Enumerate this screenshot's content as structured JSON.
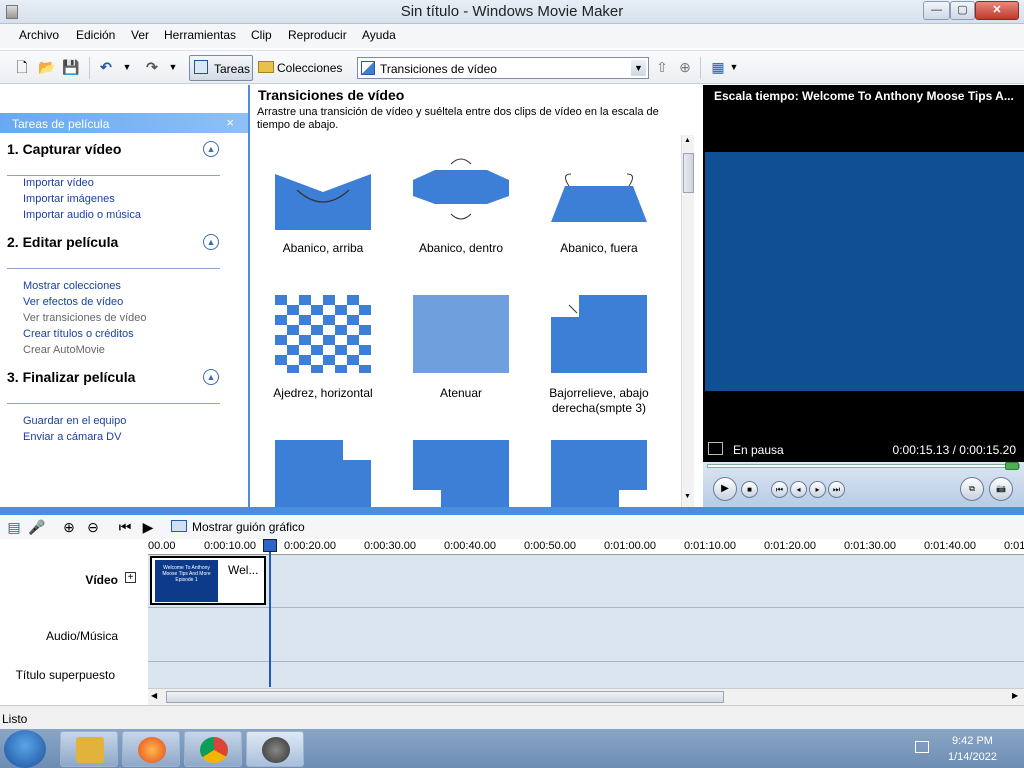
{
  "window": {
    "title": "Sin título - Windows Movie Maker",
    "minimize": "—",
    "maximize": "▢",
    "close": "✕"
  },
  "menu": [
    "Archivo",
    "Edición",
    "Ver",
    "Herramientas",
    "Clip",
    "Reproducir",
    "Ayuda"
  ],
  "toolbar": {
    "tasks": "Tareas",
    "collections": "Colecciones",
    "combo": "Transiciones de vídeo"
  },
  "tasks_pane": {
    "header": "Tareas de película",
    "close": "×",
    "sections": [
      {
        "title": "1. Capturar vídeo",
        "links": [
          "Importar vídeo",
          "Importar imágenes",
          "Importar audio o música"
        ]
      },
      {
        "title": "2. Editar película",
        "links": [
          "Mostrar colecciones",
          "Ver efectos de vídeo",
          "Ver transiciones de vídeo",
          "Crear títulos o créditos",
          "Crear AutoMovie"
        ]
      },
      {
        "title": "3. Finalizar película",
        "links": [
          "Guardar en el equipo",
          "Enviar a cámara DV"
        ]
      }
    ]
  },
  "center": {
    "title": "Transiciones de vídeo",
    "description": "Arrastre una transición de vídeo y suéltela entre dos clips de vídeo en la escala de tiempo de abajo.",
    "items": [
      "Abanico, arriba",
      "Abanico, dentro",
      "Abanico, fuera",
      "Ajedrez, horizontal",
      "Atenuar",
      "Bajorrelieve, abajo derecha(smpte 3)"
    ]
  },
  "preview": {
    "title": "Escala tiempo: Welcome To Anthony Moose Tips A...",
    "status": "En pausa",
    "time": "0:00:15.13 / 0:00:15.20"
  },
  "timeline": {
    "storyboard_button": "Mostrar guión gráfico",
    "ticks": [
      "00.00",
      "0:00:10.00",
      "0:00:20.00",
      "0:00:30.00",
      "0:00:40.00",
      "0:00:50.00",
      "0:01:00.00",
      "0:01:10.00",
      "0:01:20.00",
      "0:01:30.00",
      "0:01:40.00",
      "0:01"
    ],
    "tracks": {
      "video": "Vídeo",
      "audio": "Audio/Música",
      "title": "Título superpuesto"
    },
    "clip": {
      "label": "Wel...",
      "thumb_text": "Welcome To Anthony Moose Tips And More Episode 1"
    }
  },
  "status_bar": "Listo",
  "taskbar": {
    "time": "9:42 PM",
    "date": "1/14/2022"
  }
}
